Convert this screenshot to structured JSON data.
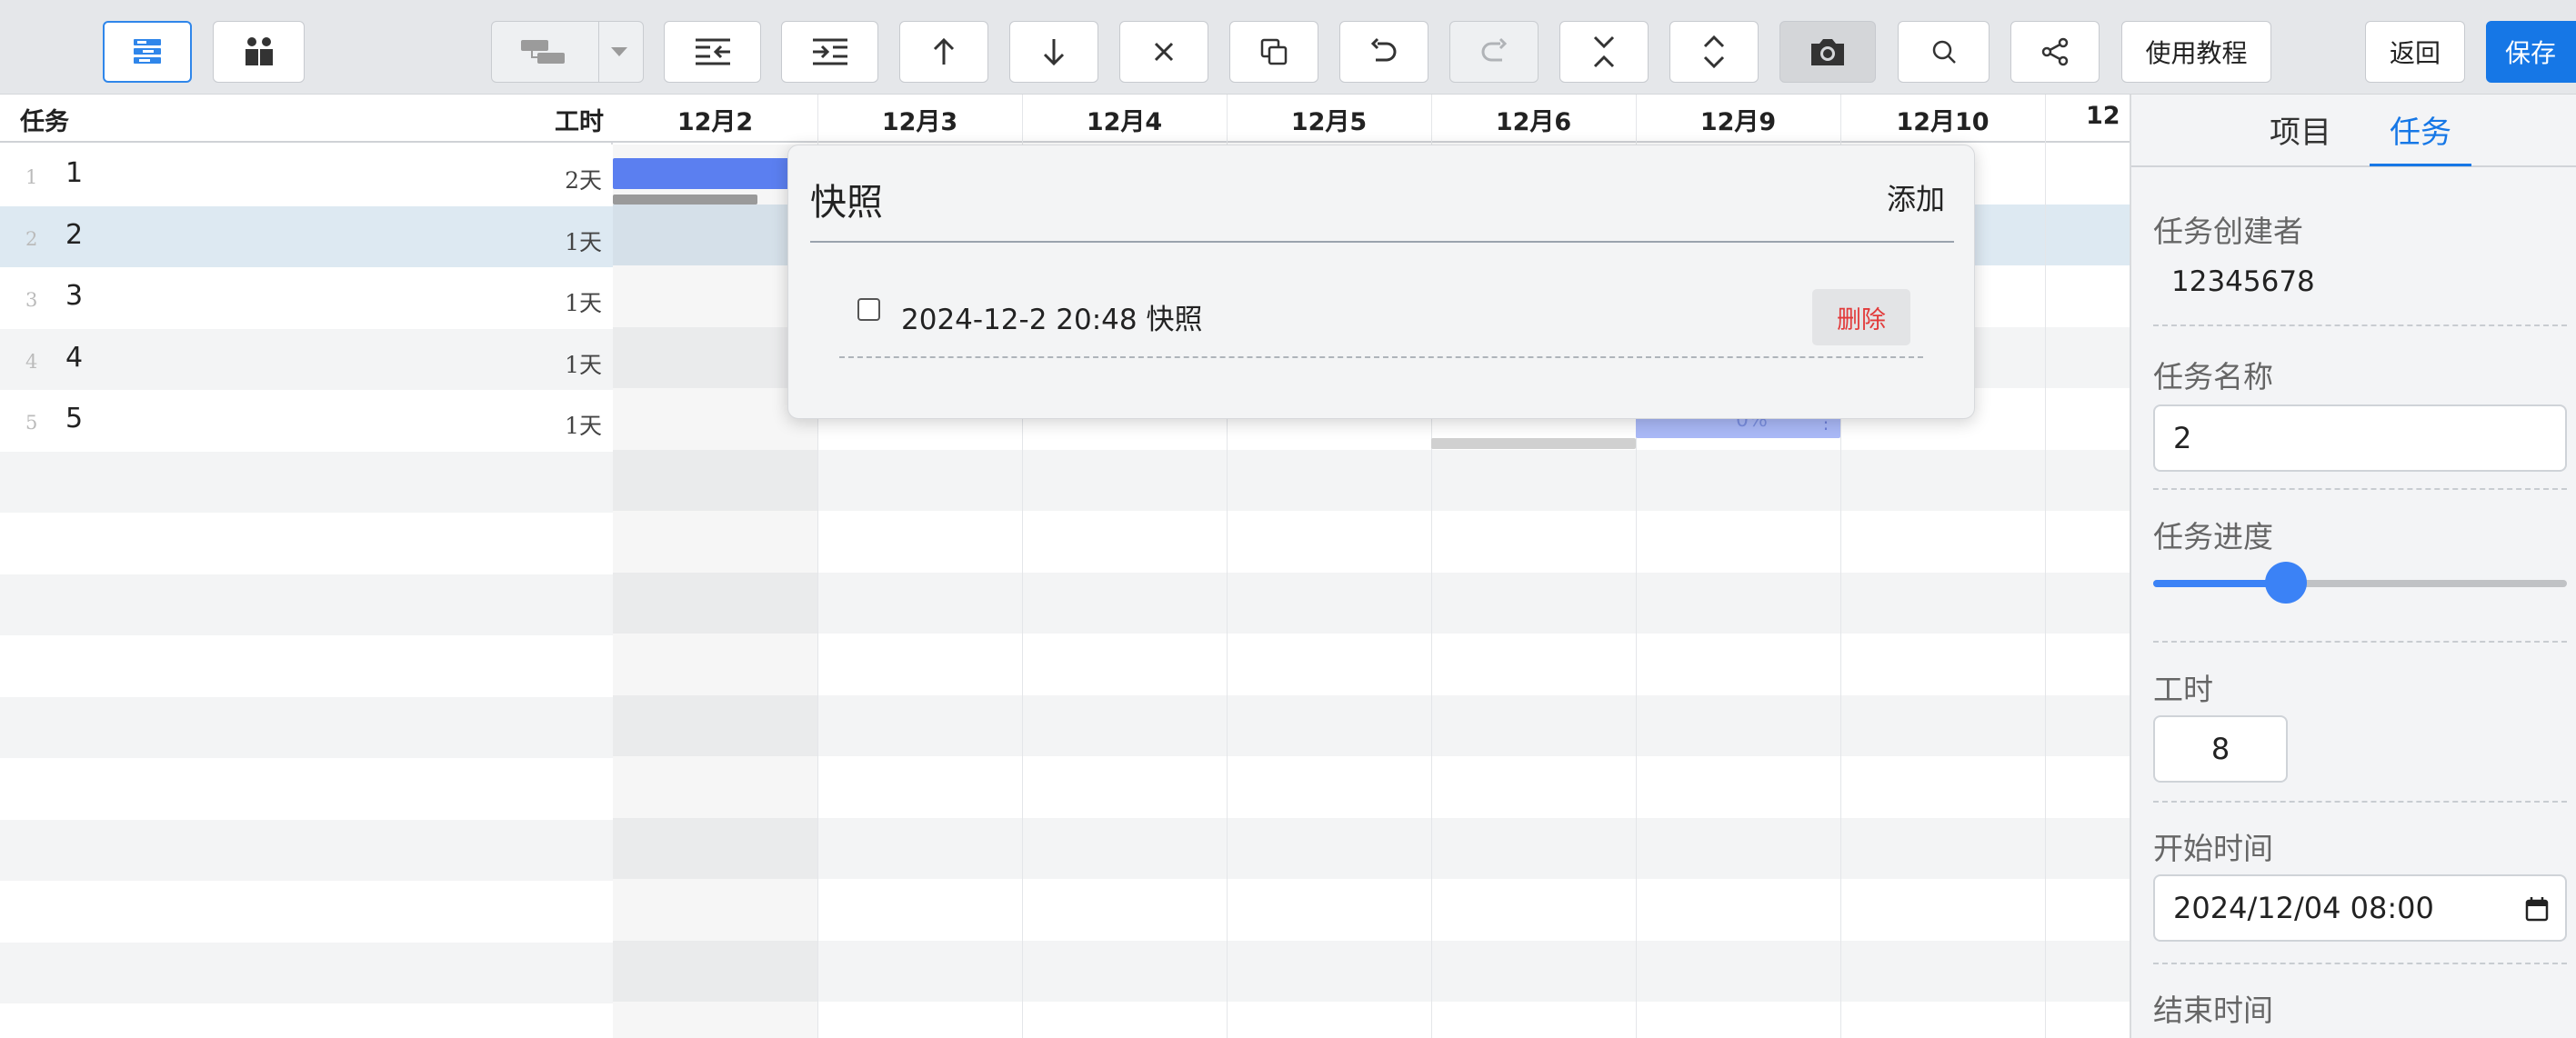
{
  "toolbar": {
    "tutorial_label": "使用教程",
    "back_label": "返回",
    "save_label": "保存",
    "icons": [
      "list-view-icon",
      "members-icon",
      "link-type-icon",
      "outdent-icon",
      "indent-icon",
      "move-up-icon",
      "move-down-icon",
      "delete-icon",
      "copy-icon",
      "undo-icon",
      "redo-icon",
      "collapse-icon",
      "expand-icon",
      "camera-icon",
      "search-icon",
      "share-icon"
    ]
  },
  "grid": {
    "header_task": "任务",
    "header_work": "工时",
    "rows": [
      {
        "num": "1",
        "name": "1",
        "duration": "2天"
      },
      {
        "num": "2",
        "name": "2",
        "duration": "1天"
      },
      {
        "num": "3",
        "name": "3",
        "duration": "1天"
      },
      {
        "num": "4",
        "name": "4",
        "duration": "1天"
      },
      {
        "num": "5",
        "name": "5",
        "duration": "1天"
      }
    ]
  },
  "gantt": {
    "dates": [
      "12月2",
      "12月3",
      "12月4",
      "12月5",
      "12月6",
      "12月9",
      "12月10",
      "12"
    ],
    "task5_progress_label": "0%"
  },
  "snapshot_popup": {
    "title": "快照",
    "add_label": "添加",
    "items": [
      {
        "label": "2024-12-2 20:48 快照",
        "delete_label": "删除",
        "checked": false
      }
    ]
  },
  "panel": {
    "tabs": [
      {
        "label": "项目"
      },
      {
        "label": "任务"
      }
    ],
    "active_tab": "任务",
    "creator_label": "任务创建者",
    "creator_value": "12345678",
    "name_label": "任务名称",
    "name_value": "2",
    "progress_label": "任务进度",
    "progress_value": 0.32,
    "work_label": "工时",
    "work_value": "8",
    "start_label": "开始时间",
    "start_value": "2024/12/04 08:00",
    "end_label": "结束时间"
  },
  "colors": {
    "accent": "#1677e6",
    "bar_blue": "#5b7ff0",
    "selected_row": "#dde9f2",
    "delete_red": "#e23a3a"
  }
}
